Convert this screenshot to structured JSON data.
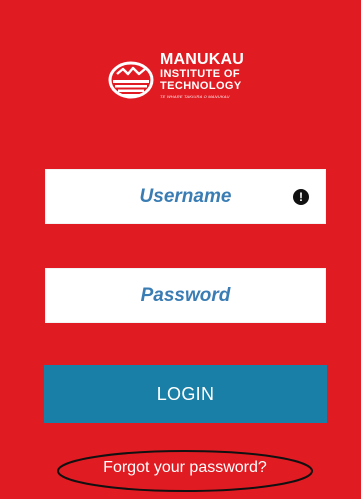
{
  "logo": {
    "name": "MANUKAU",
    "line2": "INSTITUTE OF",
    "line3": "TECHNOLOGY",
    "tagline": "Te Whare Takiura o Manukau"
  },
  "login_form": {
    "username_placeholder": "Username",
    "password_placeholder": "Password",
    "username_value": "",
    "password_value": "",
    "warning_icon": "exclamation-circle-icon",
    "login_label": "LOGIN",
    "forgot_label": "Forgot your password?"
  },
  "colors": {
    "background": "#e11b22",
    "login_button": "#1a7fa6",
    "field_text": "#2f7ab3"
  }
}
